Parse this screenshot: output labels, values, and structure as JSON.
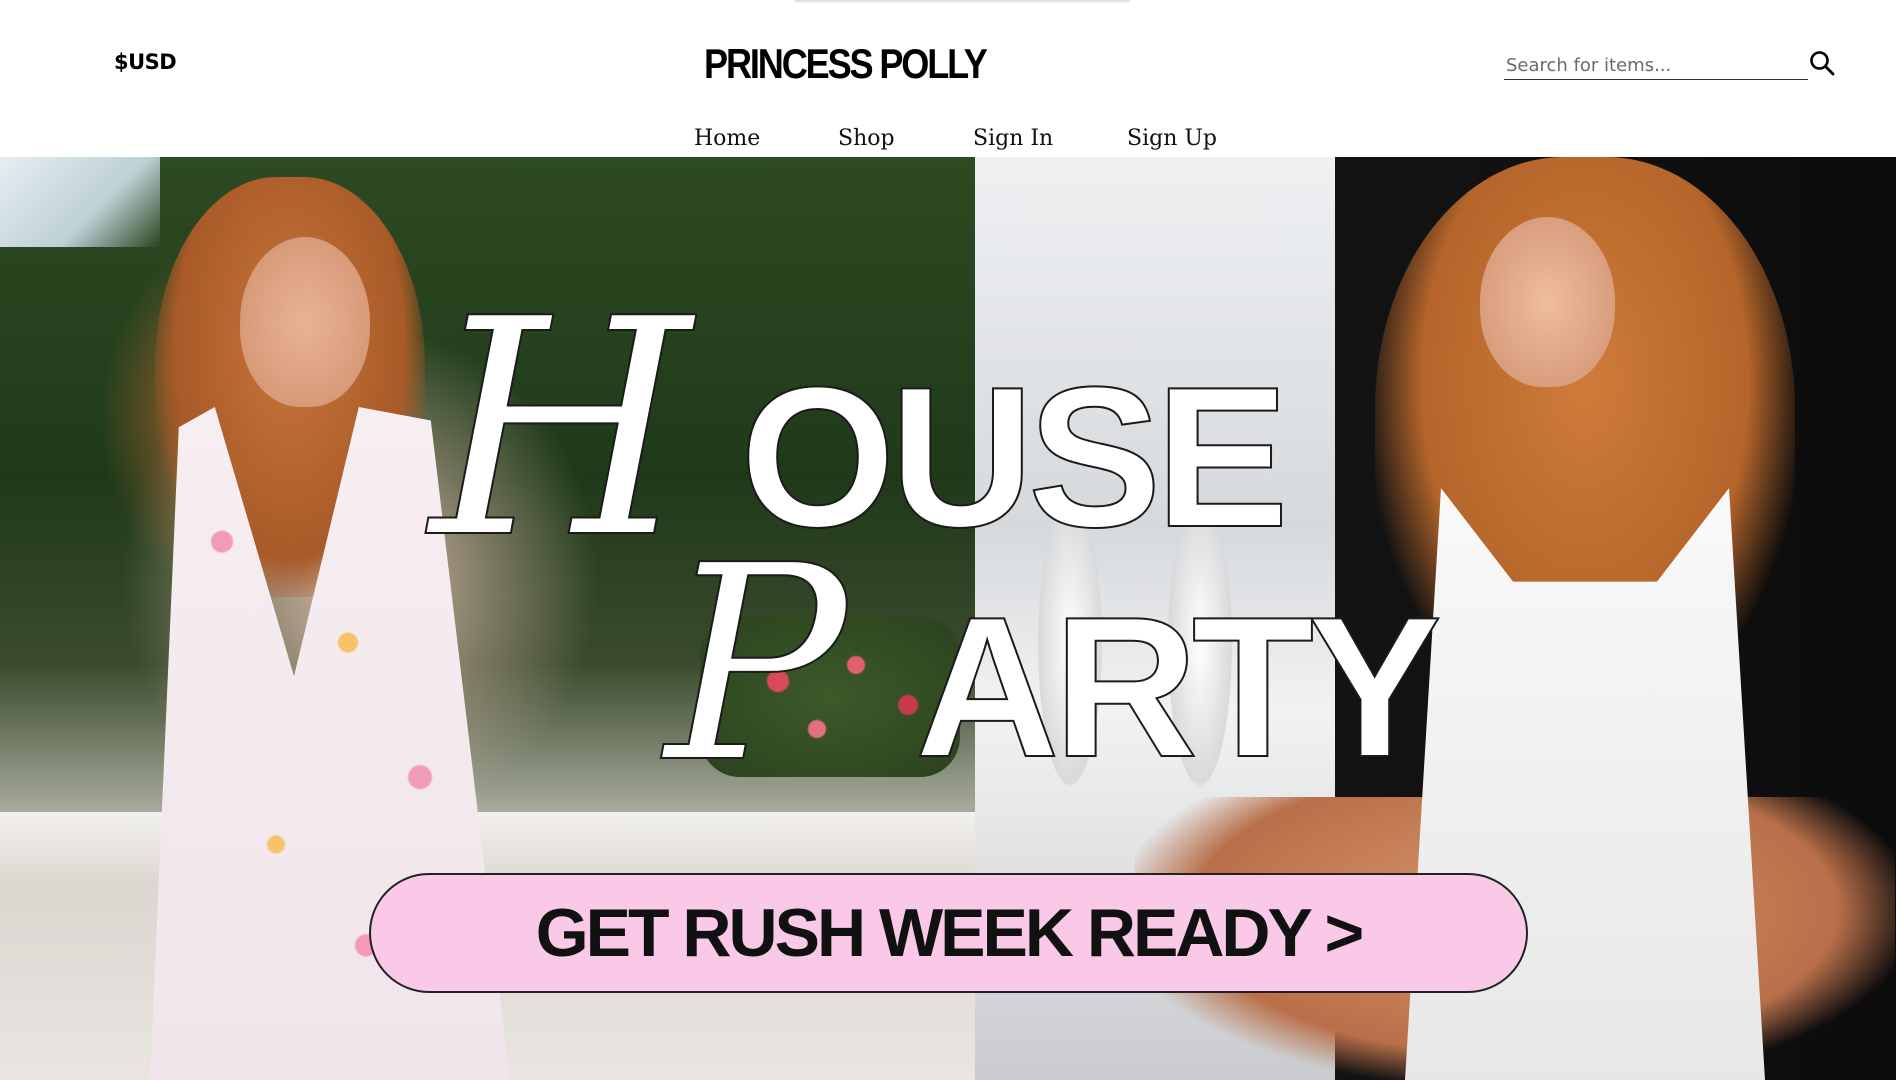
{
  "header": {
    "currency": "$USD",
    "logo": "PRINCESS POLLY",
    "search": {
      "placeholder": "Search for items...",
      "value": ""
    },
    "icons": {
      "search": "search-icon"
    }
  },
  "nav": {
    "items": [
      {
        "label": "Home"
      },
      {
        "label": "Shop"
      },
      {
        "label": "Sign In"
      },
      {
        "label": "Sign Up"
      }
    ]
  },
  "hero": {
    "title": {
      "line1_initial": "H",
      "line1_rest": "OUSE",
      "line2_initial": "P",
      "line2_rest": "ARTY"
    },
    "cta_label": "GET RUSH WEEK READY >"
  },
  "colors": {
    "cta_background": "#f9c9e7",
    "text": "#000000",
    "background": "#ffffff"
  }
}
